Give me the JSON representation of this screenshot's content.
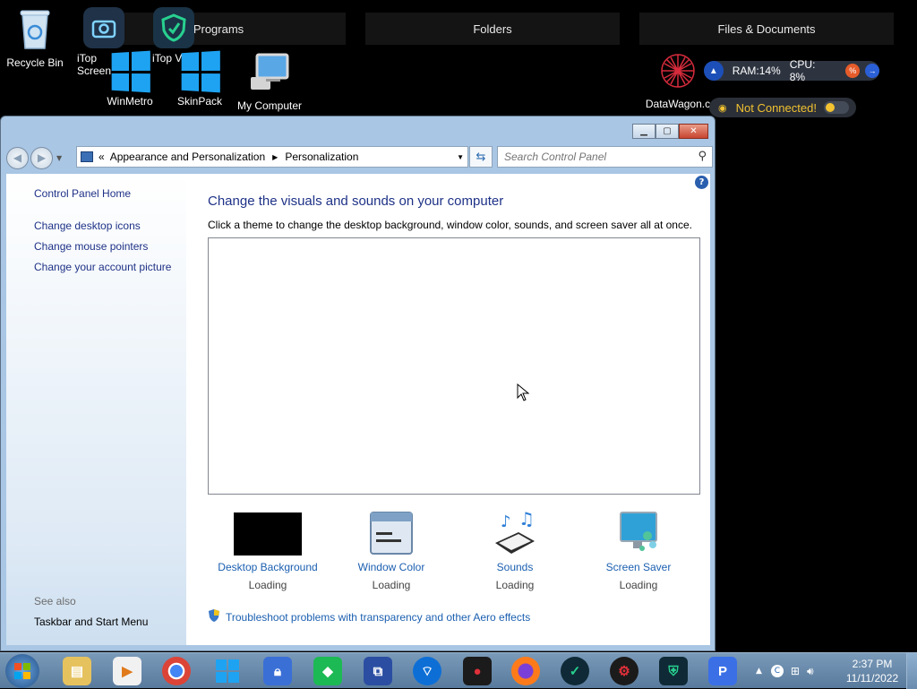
{
  "desktop": {
    "fences": [
      {
        "label": "Programs"
      },
      {
        "label": "Folders"
      },
      {
        "label": "Files & Documents"
      }
    ],
    "icons": [
      {
        "label": "Recycle Bin",
        "icon": "recycle-bin-icon"
      },
      {
        "label": "iTop Screen",
        "icon": "itop-screen-recorder-icon"
      },
      {
        "label": "iTop V",
        "icon": "itop-vpn-icon"
      },
      {
        "label": "WinMetro",
        "icon": "winmetro-icon"
      },
      {
        "label": "SkinPack",
        "icon": "skinpack-icon"
      },
      {
        "label": "My Computer",
        "icon": "my-computer-icon"
      },
      {
        "label": "DataWagon.c",
        "icon": "datawagon-icon"
      }
    ],
    "gadget": {
      "ram_label": "RAM:14%",
      "cpu_label": "CPU: 8%",
      "vpn_status": "Not Connected!"
    }
  },
  "window": {
    "breadcrumb": {
      "root": "«",
      "items": [
        "Appearance and Personalization",
        "Personalization"
      ]
    },
    "search": {
      "placeholder": "Search Control Panel"
    },
    "sidebar": {
      "home": "Control Panel Home",
      "links": [
        "Change desktop icons",
        "Change mouse pointers",
        "Change your account picture"
      ],
      "see_also_label": "See also",
      "see_also_links": [
        "Taskbar and Start Menu"
      ]
    },
    "content": {
      "title": "Change the visuals and sounds on your computer",
      "subtitle": "Click a theme to change the desktop background, window color, sounds, and screen saver all at once.",
      "options": [
        {
          "label": "Desktop Background",
          "status": "Loading",
          "icon": "desktop-background-icon"
        },
        {
          "label": "Window Color",
          "status": "Loading",
          "icon": "window-color-icon"
        },
        {
          "label": "Sounds",
          "status": "Loading",
          "icon": "sounds-icon"
        },
        {
          "label": "Screen Saver",
          "status": "Loading",
          "icon": "screen-saver-icon"
        }
      ],
      "aero_link": "Troubleshoot problems with transparency and other Aero effects"
    }
  },
  "taskbar": {
    "clock_time": "2:37 PM",
    "clock_date": "11/11/2022"
  }
}
